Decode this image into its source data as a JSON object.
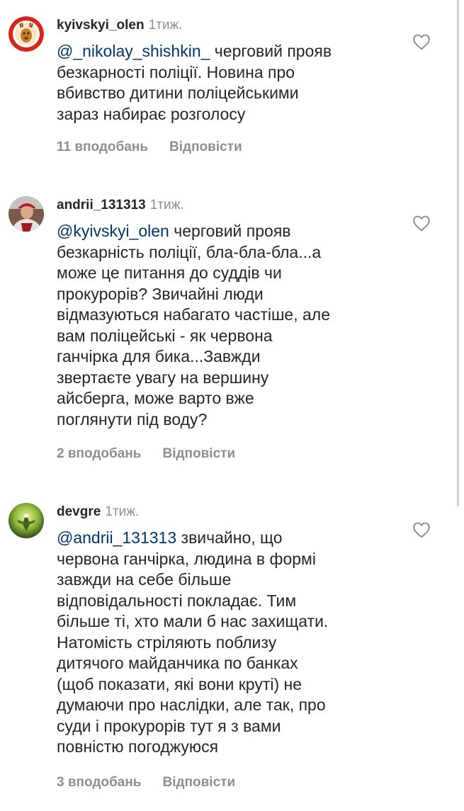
{
  "comments": [
    {
      "username": "kyivskyi_olen",
      "time": "1тиж.",
      "mention": "@_nikolay_shishkin_",
      "lines": [
        " черговий прояв",
        "безкарності поліції. Новина про",
        "вбивство дитини поліцейськими",
        "зараз набирає розголосу"
      ],
      "likes": "11 вподобань",
      "reply": "Відповісти"
    },
    {
      "username": "andrii_131313",
      "time": "1тиж.",
      "mention": "@kyivskyi_olen",
      "lines": [
        " черговий прояв",
        "безкарність поліції, бла-бла-бла...а",
        "може це питання до суддів чи",
        "прокурорів? Звичайні люди",
        "відмазуються набагато частіше, але",
        "вам поліцейські - як червона",
        "ганчірка для бика...Завжди",
        "звертаєте  увагу на вершину",
        "айсберга, може варто вже",
        "поглянути під воду?"
      ],
      "likes": "2 вподобань",
      "reply": "Відповісти"
    },
    {
      "username": "devgre",
      "time": "1тиж.",
      "mention": "@andrii_131313",
      "lines": [
        " звичайно, що",
        "червона ганчірка, людина в формі",
        "завжди на себе більше",
        "відповідальності покладає. Тим",
        "більше ті, хто мали б нас захищати.",
        "Натомість стріляють поблизу",
        "дитячого майданчика по банках",
        "(щоб показати, які вони круті) не",
        "думаючи про наслідки, але так, про",
        "суди і прокурорів тут я з вами",
        "повністю погоджуюся"
      ],
      "likes": "3 вподобань",
      "reply": "Відповісти"
    }
  ],
  "icons": {
    "like": "heart-outline-icon"
  },
  "colors": {
    "text": "#262626",
    "secondary": "#8e8e8e",
    "mention": "#00376b"
  }
}
